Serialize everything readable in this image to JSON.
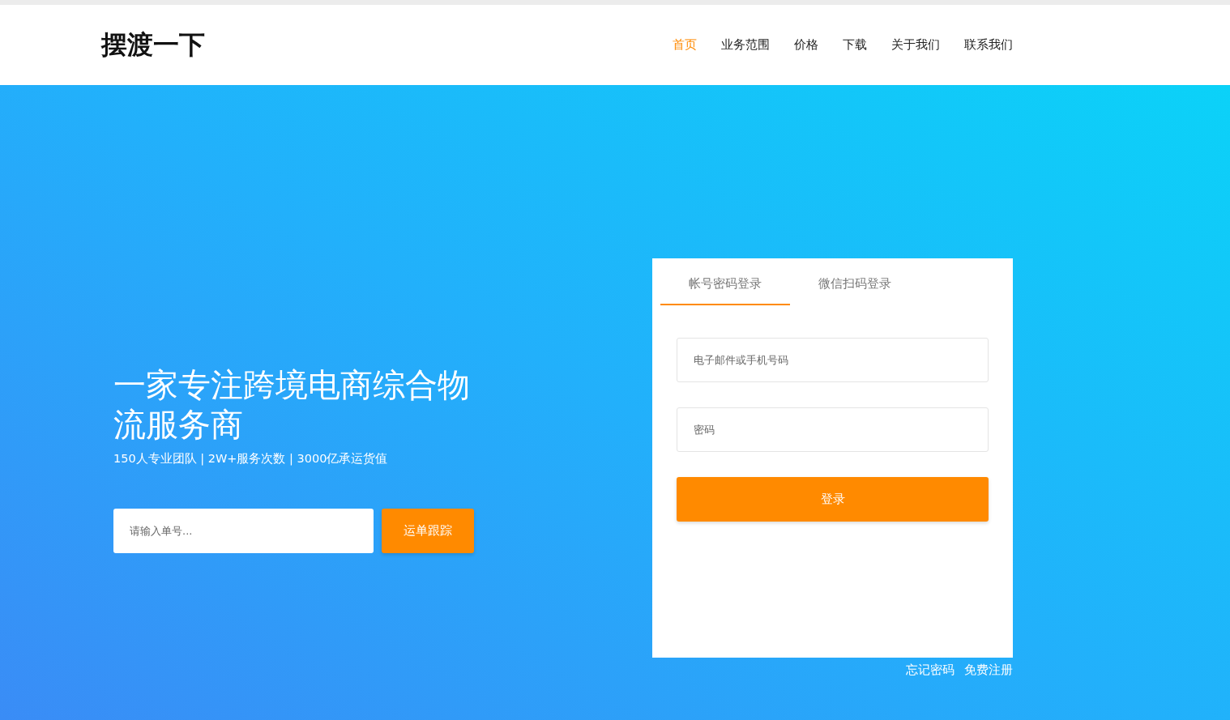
{
  "logo": "摆渡一下",
  "nav": [
    {
      "label": "首页",
      "selected": true
    },
    {
      "label": "业务范围",
      "selected": false
    },
    {
      "label": "价格",
      "selected": false
    },
    {
      "label": "下载",
      "selected": false
    },
    {
      "label": "关于我们",
      "selected": false
    },
    {
      "label": "联系我们",
      "selected": false
    }
  ],
  "hero": {
    "title": "一家专注跨境电商综合物流服务商",
    "subtitle": "150人专业团队 | 2W+服务次数 | 3000亿承运货值",
    "tracking": {
      "placeholder": "请输入单号...",
      "button": "运单跟踪"
    }
  },
  "login": {
    "tabs": [
      {
        "label": "帐号密码登录",
        "selected": true
      },
      {
        "label": "微信扫码登录",
        "selected": false
      }
    ],
    "fields": [
      {
        "placeholder": "电子邮件或手机号码"
      },
      {
        "placeholder": "密码"
      }
    ],
    "submit": "登录",
    "links": [
      "忘记密码",
      "免费注册"
    ]
  }
}
